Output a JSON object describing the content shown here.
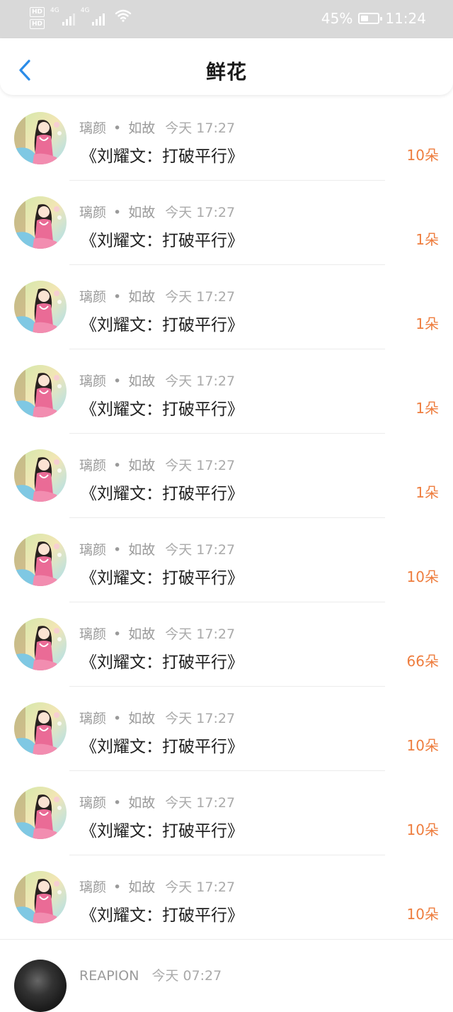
{
  "status_bar": {
    "hd_1": "HD",
    "hd_2": "HD",
    "signal_1": "4G",
    "signal_2": "4G",
    "battery_pct": "45%",
    "battery_level": 0.45,
    "time": "11:24"
  },
  "header": {
    "title": "鲜花",
    "back_icon": "chevron-left-icon"
  },
  "colors": {
    "accent_blue": "#2b8ce8",
    "count_orange": "#ee7d3e"
  },
  "items": [
    {
      "user": "璃颜",
      "dot": "•",
      "name2": "如故",
      "time": "今天 17:27",
      "book": "《刘耀文：打破平行》",
      "count": "10朵"
    },
    {
      "user": "璃颜",
      "dot": "•",
      "name2": "如故",
      "time": "今天 17:27",
      "book": "《刘耀文：打破平行》",
      "count": "1朵"
    },
    {
      "user": "璃颜",
      "dot": "•",
      "name2": "如故",
      "time": "今天 17:27",
      "book": "《刘耀文：打破平行》",
      "count": "1朵"
    },
    {
      "user": "璃颜",
      "dot": "•",
      "name2": "如故",
      "time": "今天 17:27",
      "book": "《刘耀文：打破平行》",
      "count": "1朵"
    },
    {
      "user": "璃颜",
      "dot": "•",
      "name2": "如故",
      "time": "今天 17:27",
      "book": "《刘耀文：打破平行》",
      "count": "1朵"
    },
    {
      "user": "璃颜",
      "dot": "•",
      "name2": "如故",
      "time": "今天 17:27",
      "book": "《刘耀文：打破平行》",
      "count": "10朵"
    },
    {
      "user": "璃颜",
      "dot": "•",
      "name2": "如故",
      "time": "今天 17:27",
      "book": "《刘耀文：打破平行》",
      "count": "66朵"
    },
    {
      "user": "璃颜",
      "dot": "•",
      "name2": "如故",
      "time": "今天 17:27",
      "book": "《刘耀文：打破平行》",
      "count": "10朵"
    },
    {
      "user": "璃颜",
      "dot": "•",
      "name2": "如故",
      "time": "今天 17:27",
      "book": "《刘耀文：打破平行》",
      "count": "10朵"
    },
    {
      "user": "璃颜",
      "dot": "•",
      "name2": "如故",
      "time": "今天 17:27",
      "book": "《刘耀文：打破平行》",
      "count": "10朵"
    }
  ],
  "partial_item": {
    "user": "REAPION",
    "time": "今天 07:27"
  }
}
